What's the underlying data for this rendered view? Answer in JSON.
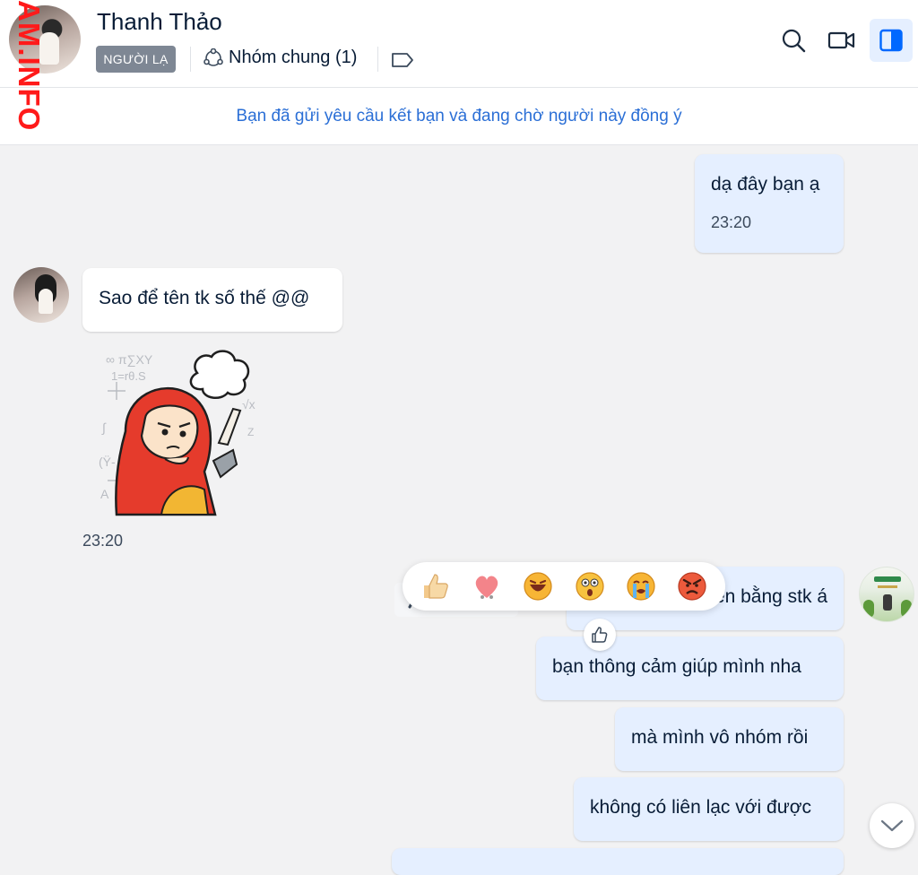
{
  "watermark": "AM.INFO",
  "header": {
    "contact_name": "Thanh Thảo",
    "badge": "NGƯỜI LẠ",
    "common_groups": "Nhóm chung (1)",
    "icons": [
      "search-icon",
      "video-call-icon",
      "sidebar-toggle-icon",
      "tag-icon",
      "group-icon"
    ]
  },
  "banner": "Bạn đã gửi yêu cầu kết bạn và đang chờ người này đồng ý",
  "messages": [
    {
      "sender": "me",
      "text": "dạ đây bạn ạ",
      "time": "23:20"
    },
    {
      "sender": "them",
      "text": "Sao để tên tk số thế @@"
    },
    {
      "sender": "them",
      "type": "sticker",
      "time": "23:20"
    },
    {
      "sender": "me",
      "text": "mình để tên bằng stk á"
    },
    {
      "sender": "me",
      "text": "bạn thông cảm giúp mình nha"
    },
    {
      "sender": "me",
      "text": "mà mình vô nhóm rồi"
    },
    {
      "sender": "me",
      "text": "không có liên lạc với được"
    }
  ],
  "reactions": [
    "thumbs-up-icon",
    "heart-icon",
    "laugh-icon",
    "surprised-icon",
    "cry-icon",
    "angry-icon"
  ],
  "colors": {
    "my_bubble": "#e5efff",
    "their_bubble": "#ffffff",
    "link_blue": "#2b6fd6",
    "badge": "#7e8794",
    "background": "#f2f2f3"
  }
}
